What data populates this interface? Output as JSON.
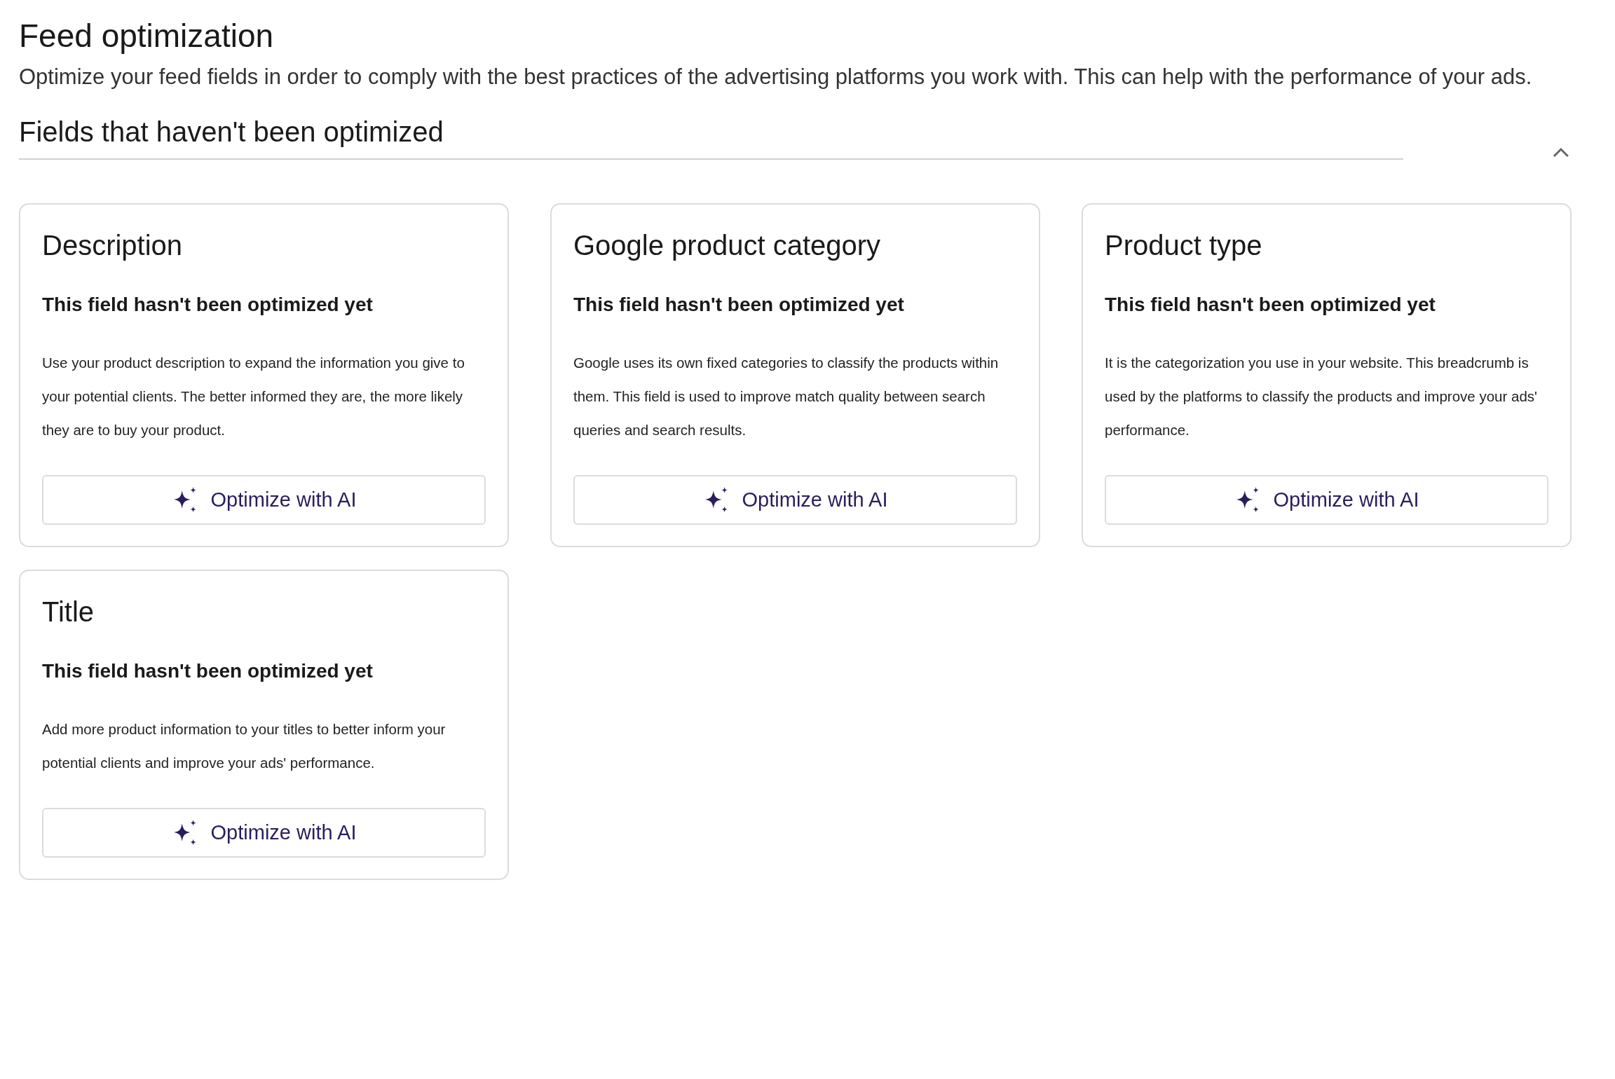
{
  "page": {
    "title": "Feed optimization",
    "description": "Optimize your feed fields in order to comply with the best practices of the advertising platforms you work with. This can help with the performance of your ads."
  },
  "section": {
    "title": "Fields that haven't been optimized",
    "expanded": true,
    "cards": [
      {
        "title": "Description",
        "status": "This field hasn't been optimized yet",
        "text": "Use your product description to expand the information you give to your potential clients. The better informed they are, the more likely they are to buy your product.",
        "button": "Optimize with AI"
      },
      {
        "title": "Google product category",
        "status": "This field hasn't been optimized yet",
        "text": "Google uses its own fixed categories to classify the products within them. This field is used to improve match quality between search queries and search results.",
        "button": "Optimize with AI"
      },
      {
        "title": "Product type",
        "status": "This field hasn't been optimized yet",
        "text": "It is the categorization you use in your website. This breadcrumb is used by the platforms to classify the products and improve your ads' performance.",
        "button": "Optimize with AI"
      },
      {
        "title": "Title",
        "status": "This field hasn't been optimized yet",
        "text": "Add more product information to your titles to better inform your potential clients and improve your ads' performance.",
        "button": "Optimize with AI"
      }
    ]
  }
}
